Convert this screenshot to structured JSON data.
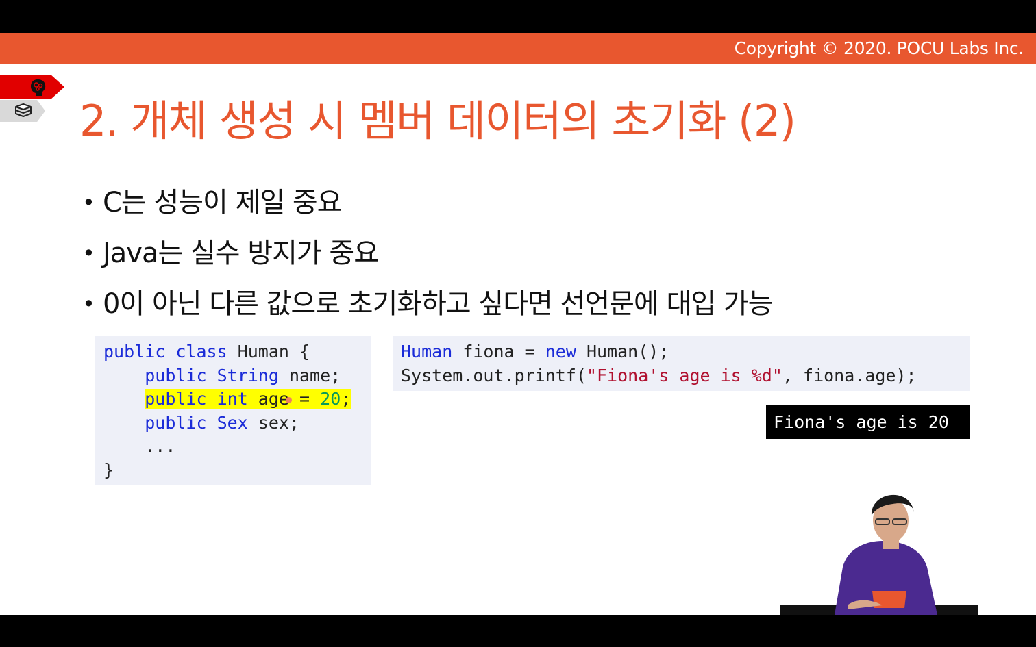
{
  "header": {
    "copyright": "Copyright © 2020. POCU Labs Inc."
  },
  "side_badges": {
    "top_icon": "brain-icon",
    "bottom_icon": "books-icon"
  },
  "slide": {
    "title": "2. 개체 생성 시 멤버 데이터의 초기화 (2)",
    "bullets": [
      "C는 성능이 제일 중요",
      "Java는 실수 방지가 중요",
      "0이 아닌 다른 값으로 초기화하고 싶다면 선언문에 대입 가능"
    ],
    "bullet_glyph": "•"
  },
  "code_left": {
    "l1_kw1": "public",
    "l1_kw2": "class",
    "l1_rest": " Human {",
    "l2_kw1": "public",
    "l2_kw2": "String",
    "l2_rest": " name;",
    "l3_kw1": "public",
    "l3_kw2": "int",
    "l3_mid": " age ",
    "l3_eq": "=",
    "l3_num": "20",
    "l3_end": ";",
    "l4_kw1": "public",
    "l4_kw2": "Sex",
    "l4_rest": " sex;",
    "l5": "...",
    "l6": "}"
  },
  "code_right": {
    "l1_type": "Human",
    "l1_mid": " fiona = ",
    "l1_kw": "new",
    "l1_rest": " Human();",
    "l2_pre": "System.out.printf(",
    "l2_str": "\"Fiona's age is %d\"",
    "l2_rest": ", fiona.age);"
  },
  "console_output": "Fiona's age is 20",
  "colors": {
    "accent": "#e8572f",
    "keyword": "#1a2bd8",
    "string": "#b0102f",
    "number": "#099a5a",
    "highlight": "#ffff00"
  }
}
